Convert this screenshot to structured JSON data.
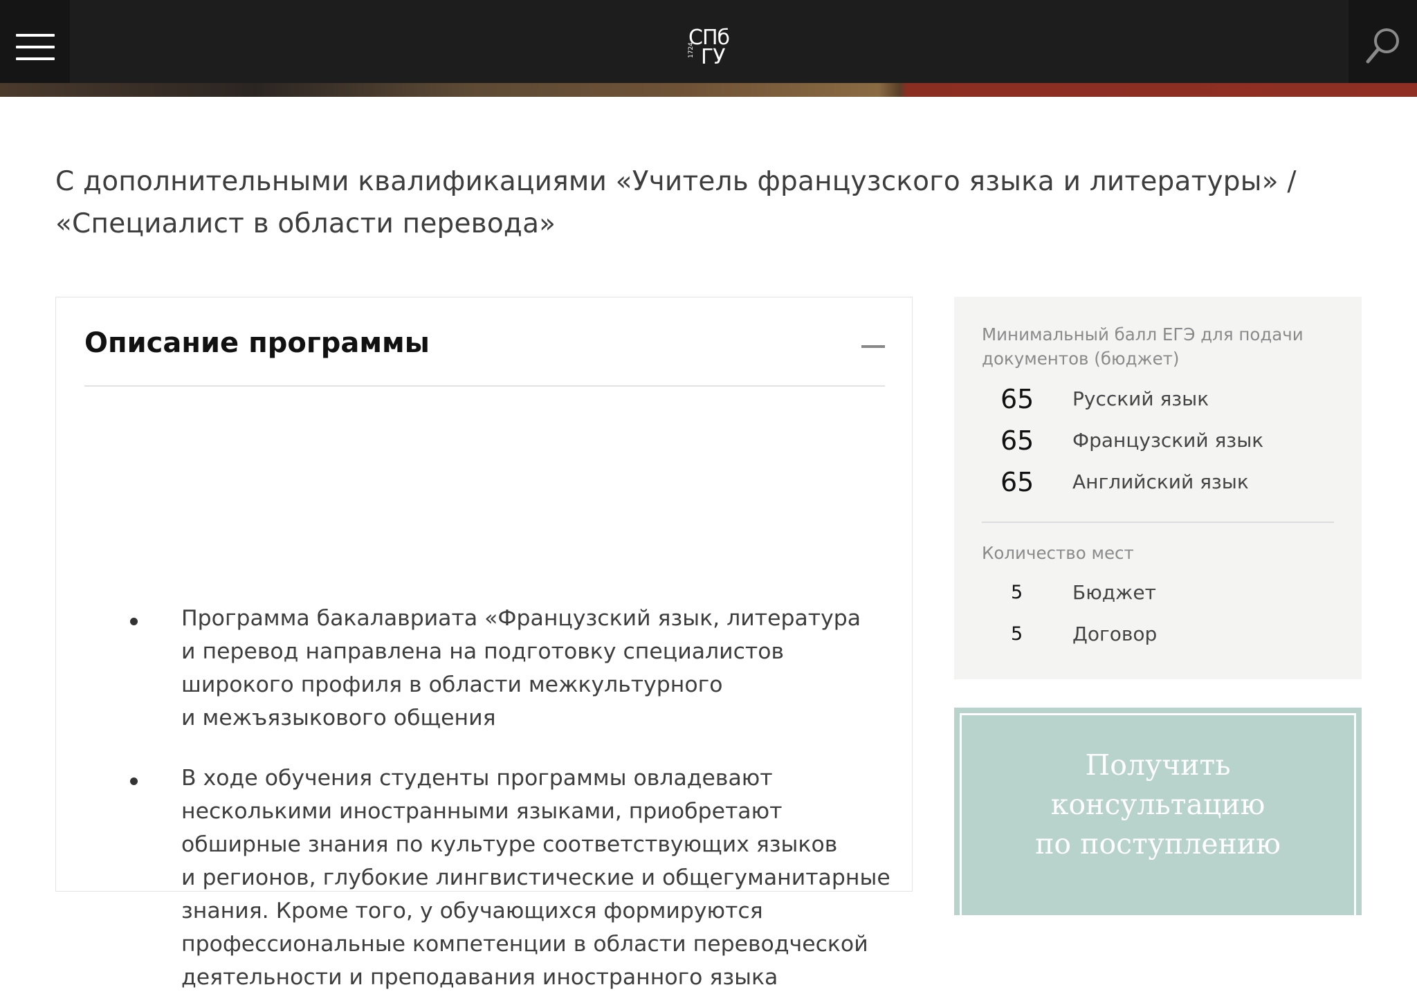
{
  "header": {
    "logo_line1": "СПб",
    "logo_line2": "ГУ",
    "logo_year": "1724",
    "menu_icon": "hamburger-menu-icon",
    "search_icon": "search-icon"
  },
  "page": {
    "subtitle": "С дополнительными квалификациями «Учитель французского языка и литературы» / «Специалист в области перевода»"
  },
  "description": {
    "title": "Описание программы",
    "collapse_icon": "minus-icon",
    "items": [
      "Программа бакалавриата «Французский язык, литература\nи перевод  направлена на подготовку специалистов\nширокого профиля в области межкультурного\nи межъязыкового общения",
      "В ходе обучения студенты программы овладевают\nнесколькими иностранными языками, приобретают\nобширные знания по культуре соответствующих языков\nи регионов, глубокие лингвистические и общегуманитарные\nзнания. Кроме того, у обучающихся формируются\nпрофессиональные компетенции в области переводческой\nдеятельности и преподавания иностранного языка"
    ]
  },
  "stats": {
    "min_score_label": "Минимальный балл ЕГЭ для подачи документов (бюджет)",
    "scores": [
      {
        "value": "65",
        "subject": "Русский язык"
      },
      {
        "value": "65",
        "subject": "Французский язык"
      },
      {
        "value": "65",
        "subject": "Английский язык"
      }
    ],
    "seats_label": "Количество мест",
    "seats": [
      {
        "value": "5",
        "type": "Бюджет"
      },
      {
        "value": "5",
        "type": "Договор"
      }
    ]
  },
  "consult": {
    "label": "Получить\nконсультацию\nпо поступлению"
  },
  "colors": {
    "header_bg": "#1d1d1d",
    "consult_bg": "#b8d2cc",
    "stats_bg": "#f4f4f2"
  }
}
